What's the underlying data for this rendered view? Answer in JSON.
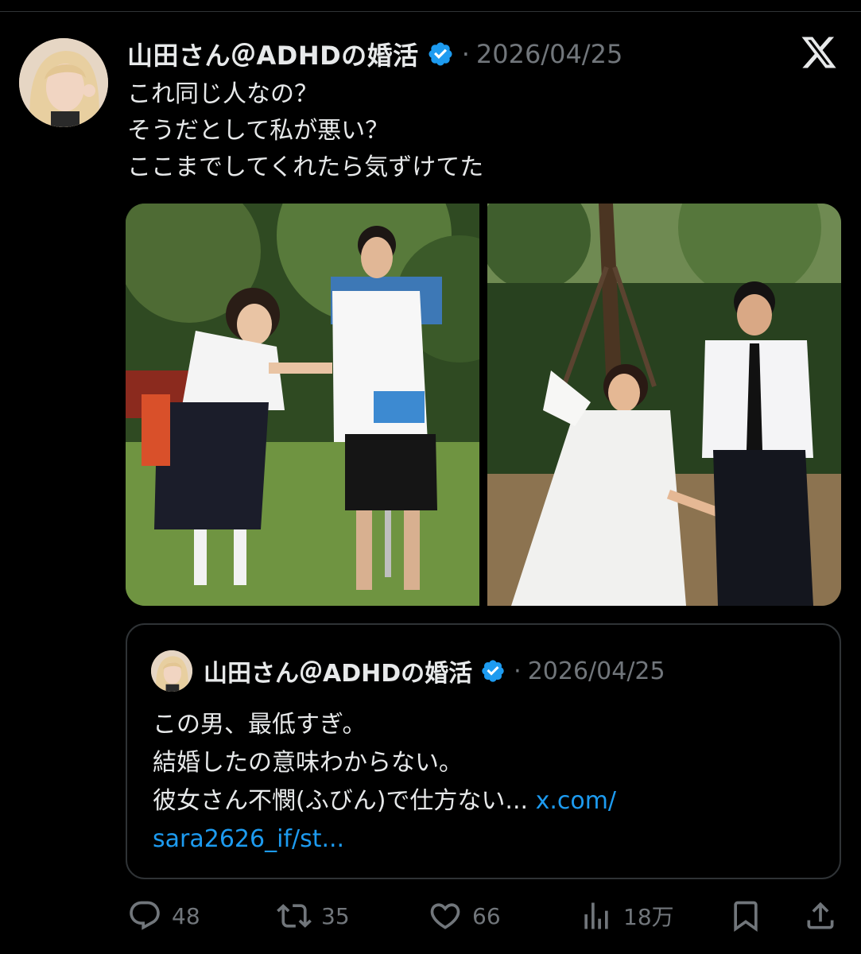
{
  "tweet": {
    "author_name": "山田さん＠ADHDの婚活",
    "separator": "·",
    "date": "2026/04/25",
    "lines": [
      "これ同じ人なの？",
      "そうだとして私が悪い？",
      "ここまでしてくれたら気ずけてた"
    ]
  },
  "quote": {
    "author_name": "山田さん＠ADHDの婚活",
    "separator": "·",
    "date": "2026/04/25",
    "line1": "この男、最低すぎ。",
    "line2": "結婚したの意味わからない。",
    "line3_text": "彼女さん不憫(ふびん)で仕方ない... ",
    "line3_link": "x.com/",
    "line4_link": "sara2626_if/st..."
  },
  "actions": {
    "reply_count": "48",
    "retweet_count": "35",
    "like_count": "66",
    "views_count": "18万"
  },
  "colors": {
    "background": "#000000",
    "text": "#e7e9ea",
    "muted": "#71767b",
    "link": "#1d9bf0",
    "verified": "#1d9bf0",
    "border": "#2f3336"
  },
  "icons": [
    "verified-badge-icon",
    "x-logo-icon",
    "reply-icon",
    "retweet-icon",
    "like-icon",
    "views-icon",
    "bookmark-icon",
    "share-icon"
  ]
}
